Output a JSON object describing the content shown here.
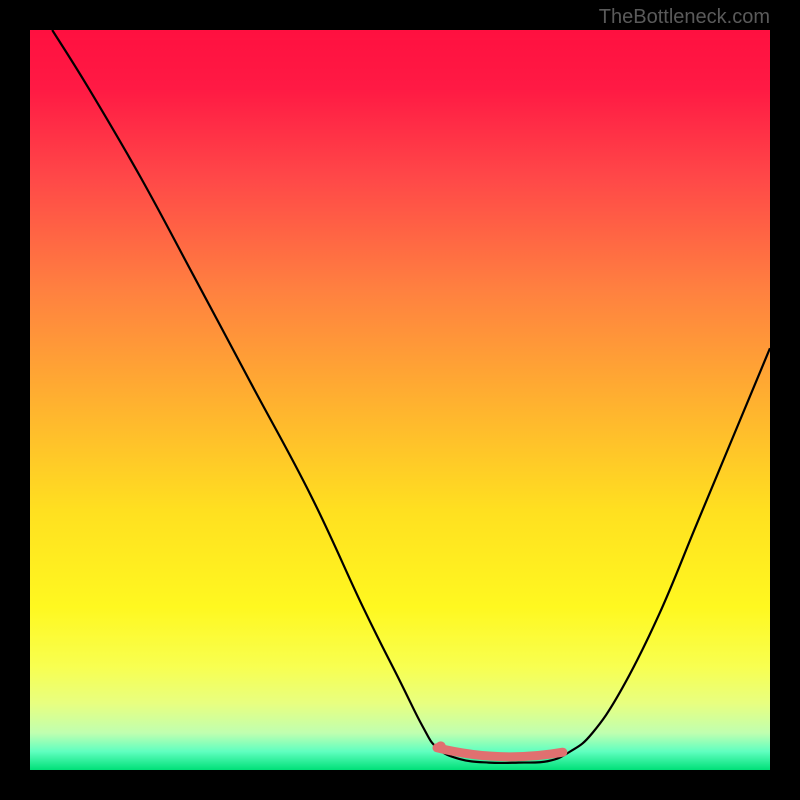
{
  "watermark": "TheBottleneck.com",
  "chart_data": {
    "type": "line",
    "title": "",
    "xlabel": "",
    "ylabel": "",
    "xlim": [
      0,
      100
    ],
    "ylim": [
      0,
      100
    ],
    "gradient_stops": [
      {
        "pos": 0.0,
        "color": "#ff1040"
      },
      {
        "pos": 0.08,
        "color": "#ff1a44"
      },
      {
        "pos": 0.2,
        "color": "#ff4848"
      },
      {
        "pos": 0.35,
        "color": "#ff8040"
      },
      {
        "pos": 0.5,
        "color": "#ffb030"
      },
      {
        "pos": 0.65,
        "color": "#ffe020"
      },
      {
        "pos": 0.78,
        "color": "#fff820"
      },
      {
        "pos": 0.86,
        "color": "#f8ff50"
      },
      {
        "pos": 0.91,
        "color": "#e8ff80"
      },
      {
        "pos": 0.95,
        "color": "#c0ffb0"
      },
      {
        "pos": 0.975,
        "color": "#60ffc0"
      },
      {
        "pos": 1.0,
        "color": "#00e078"
      }
    ],
    "series": [
      {
        "name": "curve",
        "color": "#000000",
        "points": [
          {
            "x": 3,
            "y": 100
          },
          {
            "x": 8,
            "y": 92
          },
          {
            "x": 15,
            "y": 80
          },
          {
            "x": 22,
            "y": 67
          },
          {
            "x": 30,
            "y": 52
          },
          {
            "x": 38,
            "y": 37
          },
          {
            "x": 45,
            "y": 22
          },
          {
            "x": 50,
            "y": 12
          },
          {
            "x": 53,
            "y": 6
          },
          {
            "x": 55,
            "y": 3
          },
          {
            "x": 58,
            "y": 1.5
          },
          {
            "x": 62,
            "y": 1
          },
          {
            "x": 66,
            "y": 1
          },
          {
            "x": 70,
            "y": 1.2
          },
          {
            "x": 73,
            "y": 2.5
          },
          {
            "x": 76,
            "y": 5
          },
          {
            "x": 80,
            "y": 11
          },
          {
            "x": 85,
            "y": 21
          },
          {
            "x": 90,
            "y": 33
          },
          {
            "x": 95,
            "y": 45
          },
          {
            "x": 100,
            "y": 57
          }
        ]
      }
    ],
    "marker": {
      "color": "#e07070",
      "start_x": 55,
      "end_x": 72,
      "y": 1.2,
      "dot_x": 55.5,
      "dot_y": 3.2
    }
  }
}
